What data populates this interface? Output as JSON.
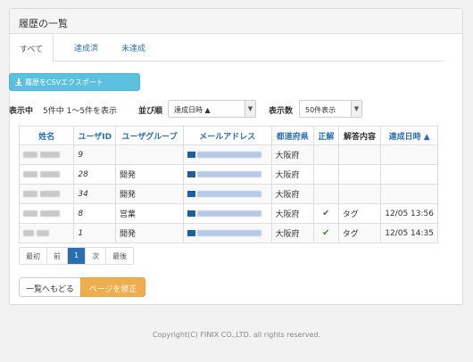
{
  "panel": {
    "title": "履歴の一覧"
  },
  "tabs": [
    {
      "label": "すべて"
    },
    {
      "label": "達成済"
    },
    {
      "label": "未達成"
    }
  ],
  "export_button": {
    "label": "履歴をCSVエクスポート",
    "icon": "download-icon"
  },
  "summary": {
    "label": "表示中",
    "text": "5件中 1〜5件を表示"
  },
  "sort": {
    "label": "並び順",
    "value": "達成日時 ▲"
  },
  "count": {
    "label": "表示数",
    "value": "50件表示"
  },
  "table": {
    "headers": [
      "姓名",
      "ユーザID",
      "ユーザグループ",
      "メールアドレス",
      "都道府県",
      "正解",
      "解答内容",
      "達成日時 ▲"
    ],
    "rows": [
      {
        "id": "9",
        "group": "",
        "pref": "大阪府",
        "correct": false,
        "answer": "",
        "date": ""
      },
      {
        "id": "28",
        "group": "開発",
        "pref": "大阪府",
        "correct": false,
        "answer": "",
        "date": ""
      },
      {
        "id": "34",
        "group": "開発",
        "pref": "大阪府",
        "correct": false,
        "answer": "",
        "date": ""
      },
      {
        "id": "8",
        "group": "営業",
        "pref": "大阪府",
        "correct": true,
        "answer": "タグ",
        "date": "12/05 13:56"
      },
      {
        "id": "1",
        "group": "開発",
        "pref": "大阪府",
        "correct": true,
        "answer": "タグ",
        "date": "12/05 14:35"
      }
    ]
  },
  "pager": {
    "first": "最初",
    "prev": "前",
    "current": "1",
    "next": "次",
    "last": "最後"
  },
  "buttons": {
    "back": "一覧へもどる",
    "edit": "ページを修正"
  },
  "footer": "Copyright(C) FINIX CO.,LTD. all rights reserved.",
  "colors": {
    "link": "#2a6fb3",
    "info": "#5bc0de",
    "warning": "#f0ad4e",
    "check": "#2f8b2f"
  }
}
